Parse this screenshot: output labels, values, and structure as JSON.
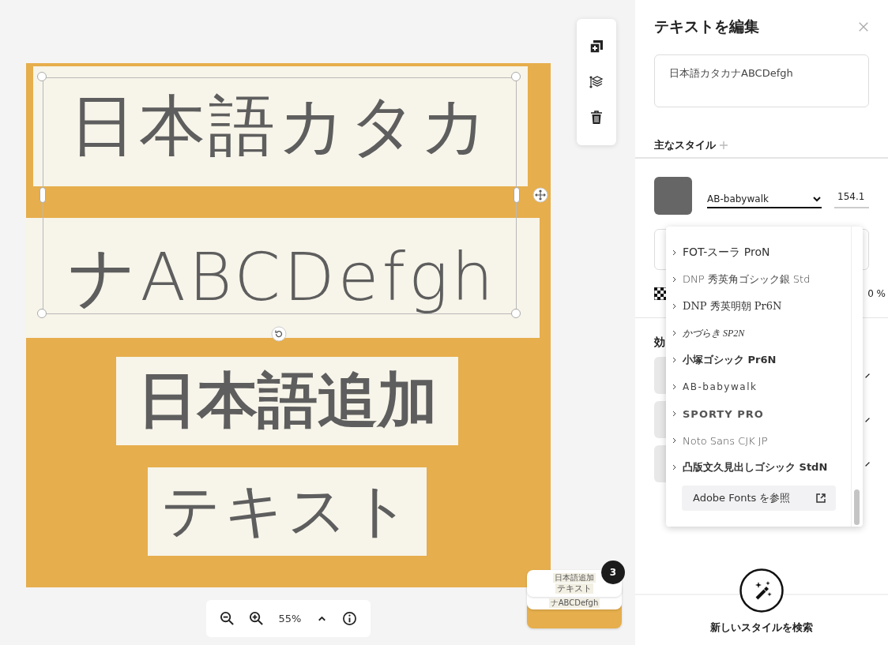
{
  "canvas": {
    "text_blocks": [
      {
        "text": "日本語カタカ",
        "kind": "rounded"
      },
      {
        "text": "ナABCDefgh",
        "kind": "rounded"
      },
      {
        "text": "日本語追加",
        "kind": "bold"
      },
      {
        "text": "テキスト",
        "kind": "medium"
      }
    ],
    "zoom": {
      "value": "55%"
    },
    "layers": {
      "count": "3",
      "thumbnails": [
        "日本語追加",
        "テキスト",
        "ナABCDefgh"
      ]
    }
  },
  "panel": {
    "title": "テキストを編集",
    "text_value": "日本語カタカナABCDefgh",
    "styles_label": "主なスタイル",
    "font": {
      "value": "AB-babywalk",
      "size": "154.1"
    },
    "opacity": "0 %",
    "effects_label": "効",
    "font_menu": {
      "items": [
        {
          "label": "FOT-スーラ ProN",
          "kind": "regular"
        },
        {
          "label": "DNP 秀英角ゴシック銀 Std",
          "kind": "light"
        },
        {
          "label": "DNP 秀英明朝 Pr6N",
          "kind": "serif"
        },
        {
          "label": "かづらき SP2N",
          "kind": "script"
        },
        {
          "label": "小塚ゴシック Pr6N",
          "kind": "bold"
        },
        {
          "label": "AB-babywalk",
          "kind": "spaced"
        },
        {
          "label": "SPORTY PRO",
          "kind": "display"
        },
        {
          "label": "Noto Sans CJK JP",
          "kind": "light"
        },
        {
          "label": "凸版文久見出しゴシック StdN",
          "kind": "bold"
        }
      ],
      "browse_button": "Adobe Fonts を参照"
    },
    "discover_label": "新しいスタイルを検索"
  }
}
